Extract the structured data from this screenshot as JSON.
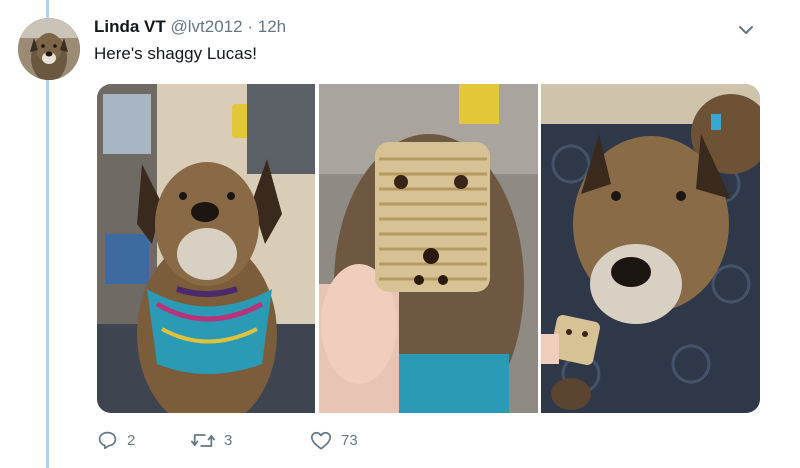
{
  "tweet": {
    "author_name": "Linda VT",
    "handle": "@lvt2012",
    "separator": "·",
    "time": "12h",
    "text": "Here's shaggy Lucas!"
  },
  "media": {
    "photos": [
      {
        "subject": "dog-with-bandana"
      },
      {
        "subject": "cereal-square-with-face"
      },
      {
        "subject": "dog-holding-cereal"
      }
    ]
  },
  "actions": {
    "reply_count": "2",
    "retweet_count": "3",
    "like_count": "73"
  },
  "icons": {
    "caret": "chevron-down-icon",
    "reply": "reply-icon",
    "retweet": "retweet-icon",
    "like": "heart-icon"
  },
  "colors": {
    "thread_line": "#a9d4f5",
    "muted_text": "#657786",
    "primary_text": "#14171a"
  }
}
